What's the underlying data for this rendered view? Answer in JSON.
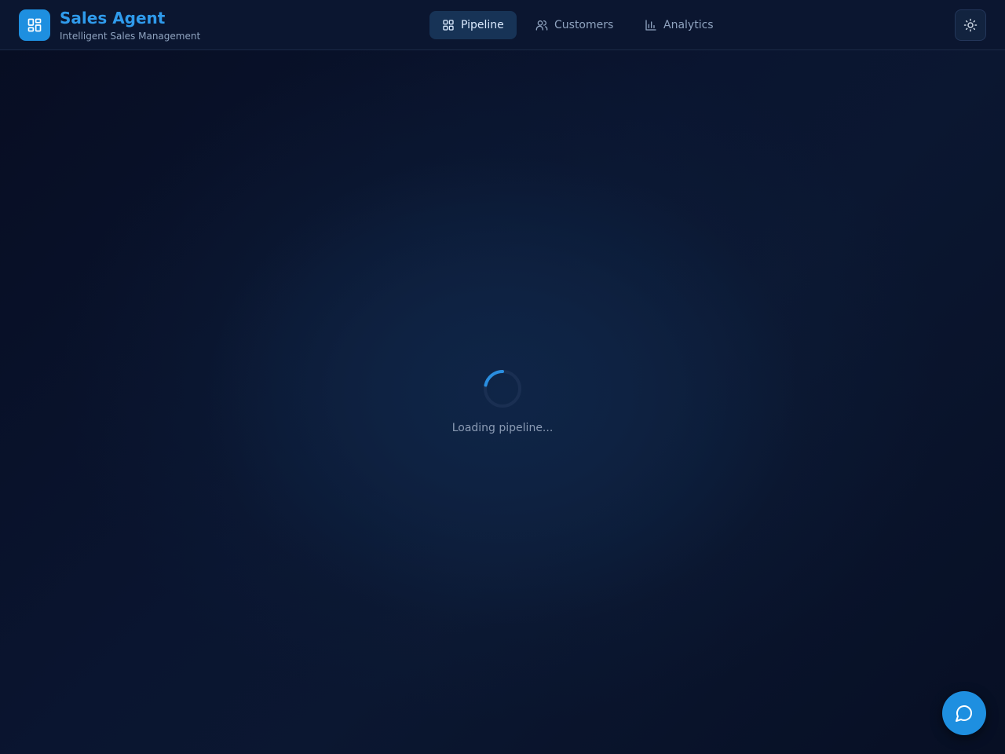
{
  "brand": {
    "title": "Sales Agent",
    "subtitle": "Intelligent Sales Management",
    "logo_icon": "dashboard-grid-icon"
  },
  "nav": {
    "active": "Pipeline",
    "items": [
      {
        "label": "Pipeline",
        "icon": "pipeline-grid-icon",
        "active": true
      },
      {
        "label": "Customers",
        "icon": "users-icon",
        "active": false
      },
      {
        "label": "Analytics",
        "icon": "bar-chart-icon",
        "active": false
      }
    ]
  },
  "theme_toggle": {
    "icon": "sun-icon"
  },
  "main": {
    "loading_text": "Loading pipeline..."
  },
  "chat": {
    "icon": "chat-bubble-icon"
  },
  "colors": {
    "accent": "#1e8fe0",
    "brand_title": "#2f9bec",
    "background": "#0a1530",
    "topbar": "#0b1630",
    "active_tab": "#173356"
  }
}
